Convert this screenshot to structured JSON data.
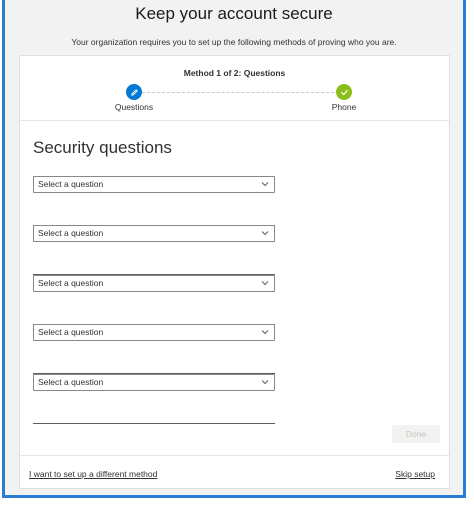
{
  "header": {
    "title": "Keep your account secure",
    "subtitle": "Your organization requires you to set up the following methods of proving who you are."
  },
  "progress": {
    "method_label": "Method 1 of 2: Questions",
    "steps": [
      {
        "label": "Questions",
        "state": "current",
        "icon": "pencil-icon"
      },
      {
        "label": "Phone",
        "state": "completed",
        "icon": "checkmark-icon"
      }
    ]
  },
  "section": {
    "title": "Security questions"
  },
  "questions": [
    {
      "placeholder": "Select a question",
      "answer": ""
    },
    {
      "placeholder": "Select a question",
      "answer": ""
    },
    {
      "placeholder": "Select a question",
      "answer": ""
    },
    {
      "placeholder": "Select a question",
      "answer": ""
    },
    {
      "placeholder": "Select a question",
      "answer": ""
    }
  ],
  "actions": {
    "done_label": "Done"
  },
  "footer": {
    "different_method_link": "I want to set up a different method",
    "skip_link": "Skip setup"
  },
  "colors": {
    "accent": "#0078d4",
    "success": "#8cbd18",
    "frame_border": "#2b7cd3"
  }
}
